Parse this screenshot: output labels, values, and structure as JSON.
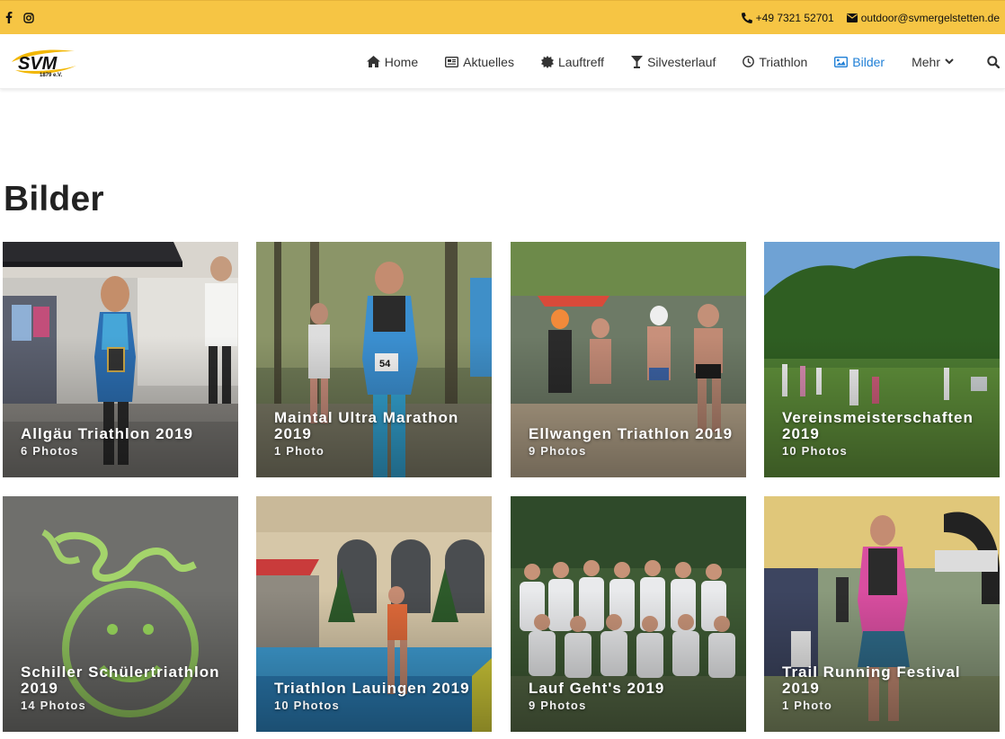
{
  "topbar": {
    "phone": "+49 7321 52701",
    "email": "outdoor@svmergelstetten.de",
    "social_icons": [
      "facebook-icon",
      "instagram-icon"
    ]
  },
  "logo": {
    "text": "SVM",
    "subtext": "1879 e.V."
  },
  "nav": {
    "items": [
      {
        "label": "Home",
        "icon": "home-icon"
      },
      {
        "label": "Aktuelles",
        "icon": "newspaper-icon"
      },
      {
        "label": "Lauftreff",
        "icon": "starburst-icon"
      },
      {
        "label": "Silvesterlauf",
        "icon": "cocktail-glass-icon"
      },
      {
        "label": "Triathlon",
        "icon": "clock-icon"
      },
      {
        "label": "Bilder",
        "icon": "image-icon",
        "active": true
      },
      {
        "label": "Mehr",
        "icon": "chevron-down-icon"
      }
    ],
    "search_icon": "search-icon",
    "active_color": "#1f7fd6"
  },
  "page": {
    "title": "Bilder"
  },
  "gallery": [
    {
      "title": "Allgäu Triathlon 2019",
      "count": "6 Photos"
    },
    {
      "title": "Maintal Ultra Marathon 2019",
      "count": "1 Photo"
    },
    {
      "title": "Ellwangen Triathlon 2019",
      "count": "9 Photos"
    },
    {
      "title": "Vereinsmeisterschaften 2019",
      "count": "10 Photos"
    },
    {
      "title": "Schiller Schülertriathlon 2019",
      "count": "14 Photos"
    },
    {
      "title": "Triathlon Lauingen 2019",
      "count": "10 Photos"
    },
    {
      "title": "Lauf Geht's 2019",
      "count": "9 Photos"
    },
    {
      "title": "Trail Running Festival 2019",
      "count": "1 Photo"
    }
  ],
  "colors": {
    "topbar": "#f6c544",
    "accent": "#1f7fd6"
  }
}
